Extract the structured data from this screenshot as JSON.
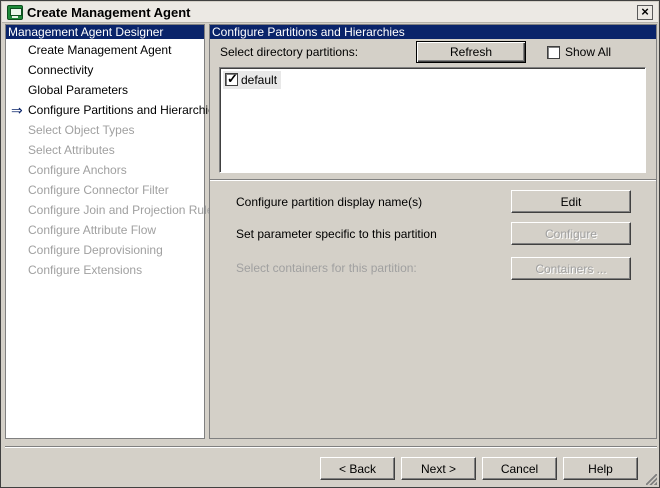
{
  "window": {
    "title": "Create Management Agent",
    "close_glyph": "×"
  },
  "left_panel": {
    "header": "Management Agent Designer",
    "items": [
      {
        "label": "Create Management Agent",
        "state": "enabled"
      },
      {
        "label": "Connectivity",
        "state": "enabled"
      },
      {
        "label": "Global Parameters",
        "state": "enabled"
      },
      {
        "label": "Configure Partitions and Hierarchies",
        "state": "current"
      },
      {
        "label": "Select Object Types",
        "state": "disabled"
      },
      {
        "label": "Select Attributes",
        "state": "disabled"
      },
      {
        "label": "Configure Anchors",
        "state": "disabled"
      },
      {
        "label": "Configure Connector Filter",
        "state": "disabled"
      },
      {
        "label": "Configure Join and Projection Rules",
        "state": "disabled"
      },
      {
        "label": "Configure Attribute Flow",
        "state": "disabled"
      },
      {
        "label": "Configure Deprovisioning",
        "state": "disabled"
      },
      {
        "label": "Configure Extensions",
        "state": "disabled"
      }
    ],
    "current_arrow": "⇒"
  },
  "right_panel": {
    "header": "Configure Partitions and Hierarchies",
    "select_label": "Select directory partitions:",
    "refresh_label": "Refresh",
    "show_all_label": "Show All",
    "show_all_checked": false,
    "partitions": [
      {
        "name": "default",
        "checked": true
      }
    ],
    "display_name_label": "Configure partition display name(s)",
    "edit_label": "Edit",
    "param_label": "Set parameter specific to this partition",
    "configure_label": "Configure",
    "containers_label_text": "Select containers for this partition:",
    "containers_button_label": "Containers ..."
  },
  "footer": {
    "back_label": "< Back",
    "next_label": "Next >",
    "cancel_label": "Cancel",
    "help_label": "Help"
  },
  "colors": {
    "header_bg": "#0a246a",
    "dialog_bg": "#d4d0c8",
    "disabled_text": "#a0a0a0"
  }
}
